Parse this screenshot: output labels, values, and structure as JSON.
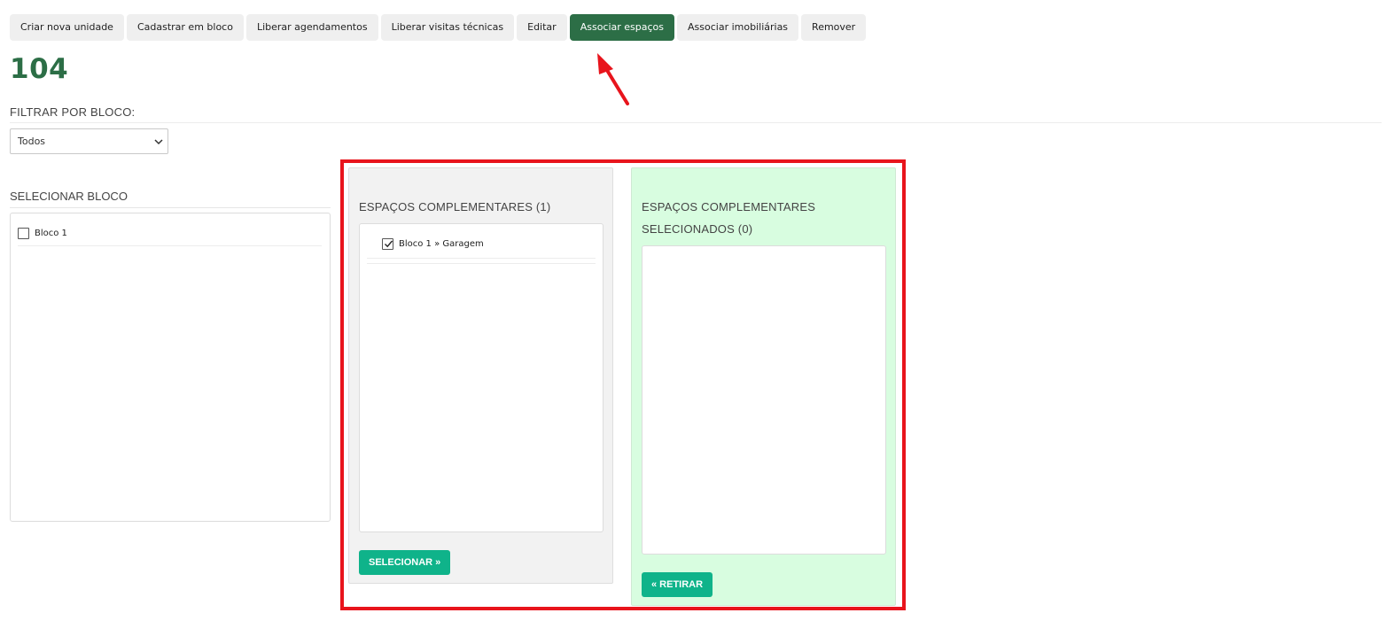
{
  "toolbar": {
    "buttons": [
      {
        "label": "Criar nova unidade"
      },
      {
        "label": "Cadastrar em bloco"
      },
      {
        "label": "Liberar agendamentos"
      },
      {
        "label": "Liberar visitas técnicas"
      },
      {
        "label": "Editar"
      },
      {
        "label": "Associar espaços",
        "active": true
      },
      {
        "label": "Associar imobiliárias"
      },
      {
        "label": "Remover"
      }
    ]
  },
  "unit": {
    "title": "104"
  },
  "filter": {
    "label": "FILTRAR POR BLOCO:",
    "selected": "Todos"
  },
  "select_block": {
    "label": "SELECIONAR BLOCO",
    "items": [
      {
        "label": "Bloco 1",
        "checked": false
      }
    ]
  },
  "available_spaces": {
    "heading": "ESPAÇOS COMPLEMENTARES (1)",
    "items": [
      {
        "label": "Bloco 1 » Garagem",
        "checked": true
      }
    ],
    "button": "SELECIONAR »"
  },
  "selected_spaces": {
    "heading": "ESPAÇOS COMPLEMENTARES SELECIONADOS (0)",
    "items": [],
    "button": "« RETIRAR"
  },
  "colors": {
    "brand_green": "#2c6e46",
    "action_green": "#0fb38a",
    "highlight_red": "#e8141c",
    "selected_panel_bg": "#d8fde0"
  }
}
